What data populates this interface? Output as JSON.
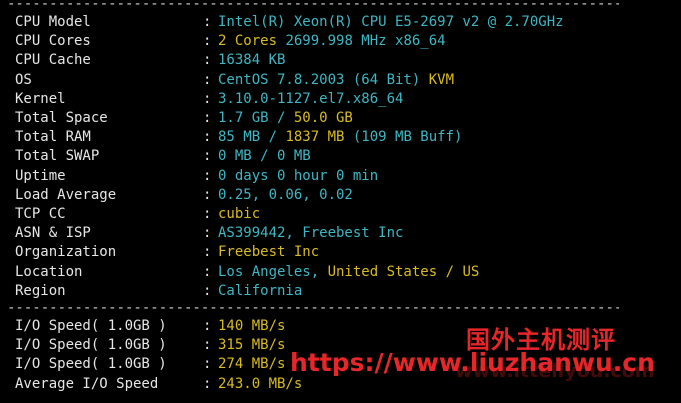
{
  "separator": "--------------------------------------------------------------------------------",
  "colon": ":",
  "info_rows": [
    {
      "label": "CPU Model",
      "segments": [
        {
          "text": "Intel(R) Xeon(R) CPU E5-2697 v2 @ 2.70GHz",
          "color": "cyan"
        }
      ]
    },
    {
      "label": "CPU Cores",
      "segments": [
        {
          "text": "2 Cores ",
          "color": "yellow"
        },
        {
          "text": "2699.998 MHz x86_64",
          "color": "cyan"
        }
      ]
    },
    {
      "label": "CPU Cache",
      "segments": [
        {
          "text": "16384 KB",
          "color": "cyan"
        }
      ]
    },
    {
      "label": "OS",
      "segments": [
        {
          "text": "CentOS 7.8.2003 (64 Bit) ",
          "color": "cyan"
        },
        {
          "text": "KVM",
          "color": "yellow"
        }
      ]
    },
    {
      "label": "Kernel",
      "segments": [
        {
          "text": "3.10.0-1127.el7.x86_64",
          "color": "cyan"
        }
      ]
    },
    {
      "label": "Total Space",
      "segments": [
        {
          "text": "1.7 GB / ",
          "color": "cyan"
        },
        {
          "text": "50.0 GB",
          "color": "yellow"
        }
      ]
    },
    {
      "label": "Total RAM",
      "segments": [
        {
          "text": "85 MB / ",
          "color": "cyan"
        },
        {
          "text": "1837 MB",
          "color": "yellow"
        },
        {
          "text": " (109 MB Buff)",
          "color": "cyan"
        }
      ]
    },
    {
      "label": "Total SWAP",
      "segments": [
        {
          "text": "0 MB / 0 MB",
          "color": "cyan"
        }
      ]
    },
    {
      "label": "Uptime",
      "segments": [
        {
          "text": "0 days 0 hour 0 min",
          "color": "cyan"
        }
      ]
    },
    {
      "label": "Load Average",
      "segments": [
        {
          "text": "0.25, 0.06, 0.02",
          "color": "cyan"
        }
      ]
    },
    {
      "label": "TCP CC",
      "segments": [
        {
          "text": "cubic",
          "color": "yellow"
        }
      ]
    },
    {
      "label": "ASN & ISP",
      "segments": [
        {
          "text": "AS399442, Freebest Inc",
          "color": "cyan"
        }
      ]
    },
    {
      "label": "Organization",
      "segments": [
        {
          "text": "Freebest Inc",
          "color": "yellow"
        }
      ]
    },
    {
      "label": "Location",
      "segments": [
        {
          "text": "Los Angeles, ",
          "color": "cyan"
        },
        {
          "text": "United States / US",
          "color": "yellow"
        }
      ]
    },
    {
      "label": "Region",
      "segments": [
        {
          "text": "California",
          "color": "cyan"
        }
      ]
    }
  ],
  "io_rows": [
    {
      "label": "I/O Speed( 1.0GB )",
      "segments": [
        {
          "text": "140 MB/s",
          "color": "yellow"
        }
      ]
    },
    {
      "label": "I/O Speed( 1.0GB )",
      "segments": [
        {
          "text": "315 MB/s",
          "color": "yellow"
        }
      ]
    },
    {
      "label": "I/O Speed( 1.0GB )",
      "segments": [
        {
          "text": "274 MB/s",
          "color": "yellow"
        }
      ]
    },
    {
      "label": "Average I/O Speed",
      "segments": [
        {
          "text": "243.0 MB/s",
          "color": "yellow"
        }
      ]
    }
  ],
  "watermark": {
    "site_name": "国外主机测评",
    "url": "https://www.liuzhanwu.cn",
    "url_faint": "www.ittellyou.com"
  },
  "colors": {
    "cyan": "#3fb6c2",
    "yellow": "#d8bc1f",
    "text": "#e6e6e6",
    "background": "#000000",
    "watermark": "#e8262a"
  }
}
